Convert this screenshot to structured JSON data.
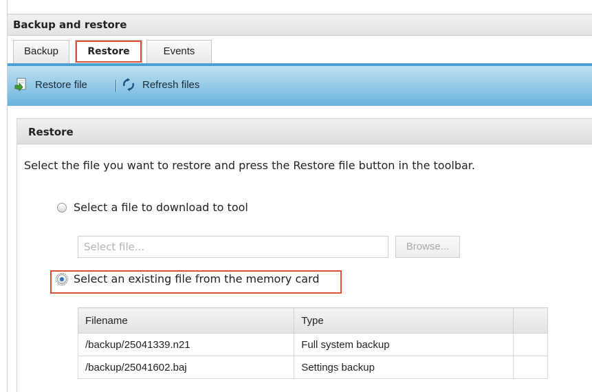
{
  "window": {
    "title": "Backup and restore"
  },
  "tabs": [
    {
      "label": "Backup"
    },
    {
      "label": "Restore",
      "active": true
    },
    {
      "label": "Events"
    }
  ],
  "toolbar": {
    "restore_label": "Restore file",
    "refresh_label": "Refresh files"
  },
  "restore_section": {
    "title": "Restore",
    "instruction": "Select the file you want to restore and press the Restore file button in the toolbar.",
    "option_download": {
      "label": "Select a file to download to tool",
      "selected": false
    },
    "file_input": {
      "placeholder": "Select file...",
      "value": ""
    },
    "browse_label": "Browse...",
    "option_memory": {
      "label": "Select an existing file from the memory card",
      "selected": true
    },
    "table": {
      "headers": [
        "Filename",
        "Type"
      ],
      "rows": [
        {
          "filename": "/backup/25041339.n21",
          "type": "Full system backup"
        },
        {
          "filename": "/backup/25041602.baj",
          "type": "Settings backup"
        }
      ]
    }
  },
  "colors": {
    "accent_blue": "#4a9fd3",
    "highlight_red": "#e04e39"
  }
}
